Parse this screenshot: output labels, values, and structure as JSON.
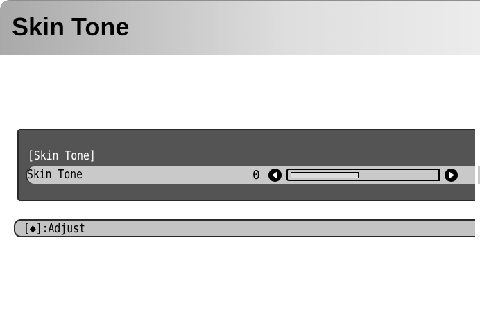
{
  "header": {
    "title": "Skin Tone"
  },
  "osd": {
    "section_label": "[Skin Tone]",
    "row": {
      "label": "Skin Tone",
      "value": "0",
      "slider_fraction": 0.47
    }
  },
  "hint": {
    "text": "[◆]:Adjust"
  },
  "icons": {
    "left": "left-arrow-icon",
    "right": "right-arrow-icon"
  },
  "colors": {
    "panel_bg": "#545454",
    "row_highlight": "#c9c9c9",
    "hint_bg": "#c3c3c3",
    "title_gradient_start": "#a9a9a9",
    "title_gradient_end": "#ececec"
  }
}
